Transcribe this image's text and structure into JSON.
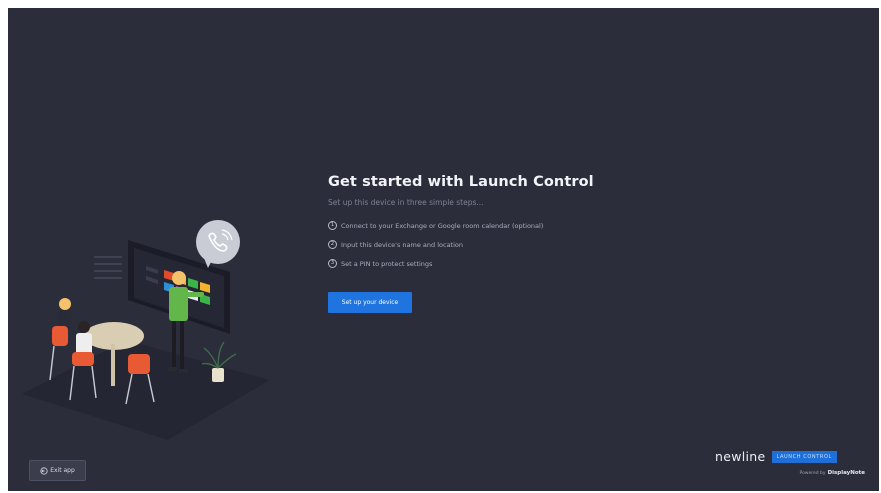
{
  "main": {
    "title": "Get started with Launch Control",
    "subtitle": "Set up this device in three simple steps...",
    "steps": [
      {
        "number": "1",
        "text": "Connect to your Exchange or Google room calendar (optional)"
      },
      {
        "number": "2",
        "text": "Input this device's name and location"
      },
      {
        "number": "3",
        "text": "Set a PIN to protect settings"
      }
    ],
    "cta_label": "Set up your device"
  },
  "footer": {
    "exit_label": "Exit app",
    "brand_name": "newline",
    "brand_badge": "LAUNCH CONTROL",
    "powered_by": "Powered by",
    "powered_brand": "DisplayNote"
  },
  "icons": {
    "exit": "exit-icon",
    "call": "phone-call-icon",
    "step_marker": "numbered-circle-icon"
  },
  "colors": {
    "background": "#2c2d3b",
    "accent": "#1f74e0",
    "text_primary": "#f2f3f6",
    "text_secondary": "#a9adbd"
  }
}
